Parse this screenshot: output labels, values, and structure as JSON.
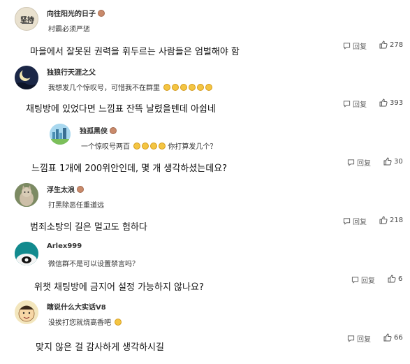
{
  "comments": [
    {
      "username": "向往阳光的日子",
      "avatar_text": "坚持",
      "text": "村霸必须严惩",
      "translation": "마을에서 잘못된 권력을 휘두르는 사람들은 엄벌해야 함",
      "reply_label": "回复",
      "likes": "278"
    },
    {
      "username": "独狼行天涯之父",
      "text": "我想发几个惊叹号，可惜我不在群里",
      "translation": "채팅방에 있었다면 느낌표 잔뜩 날렸을텐데 아쉽네",
      "reply_label": "回复",
      "likes": "393",
      "nested": {
        "username": "独孤黑侠",
        "text_before": "一个惊叹号两百",
        "text_after": "你打算发几个？",
        "translation": "느낌표 1개에 200위안인데, 몇 개 생각하셨는데요?",
        "reply_label": "回复",
        "likes": "30"
      }
    },
    {
      "username": "浮生太浪",
      "text": "打黑除恶任重道远",
      "translation": "범죄소탕의 길은 멀고도 험하다",
      "reply_label": "回复",
      "likes": "218"
    },
    {
      "username": "Arlex999",
      "text": "微信群不是可以设置禁言吗？",
      "translation": "위챗 채팅방에 금지어 설정 가능하지 않나요?",
      "reply_label": "回复",
      "likes": "6"
    },
    {
      "username": "瞎说什么大实话V8",
      "text": "没挨打您就烧高香吧",
      "translation": "맞지 않은 걸 감사하게 생각하시길",
      "reply_label": "回复",
      "likes": "66"
    }
  ],
  "colors": {
    "text": "#333333",
    "muted": "#666666",
    "badge": "#c98a6b",
    "emoji": "#f4c542"
  },
  "icons": [
    "reply-icon",
    "thumbs-up-icon",
    "user-badge-icon",
    "emoji-icon"
  ]
}
